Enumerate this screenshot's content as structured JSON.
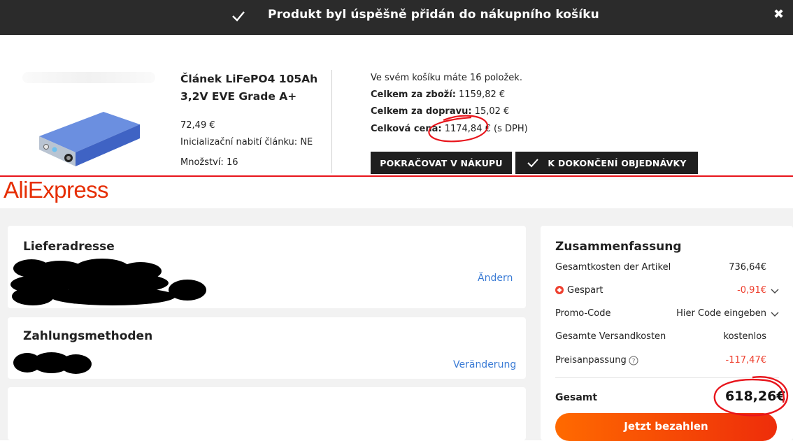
{
  "notification": {
    "message": "Produkt byl úspěšně přidán do nákupního košíku",
    "close_glyph": "✖",
    "icons": {
      "check": "check-icon",
      "close": "close-icon"
    }
  },
  "cart_popup": {
    "product": {
      "name": "Článek LiFePO4 105Ah 3,2V EVE Grade A+",
      "price": "72,49 €",
      "init_label": "Inicializační nabití článku:",
      "init_value": "NE",
      "qty_label": "Množství:",
      "qty_value": "16"
    },
    "summary": {
      "items_text": "Ve svém košíku máte 16 položek.",
      "goods_label": "Celkem za zboží:",
      "goods_value": "1159,82 €",
      "shipping_label": "Celkem za dopravu:",
      "shipping_value": "15,02 €",
      "total_label": "Celková cena:",
      "total_value": "1174,84 € (s DPH)"
    },
    "buttons": {
      "continue": "POKRAČOVAT V NÁKUPU",
      "checkout": "K DOKONČENÍ OBJEDNÁVKY"
    }
  },
  "aliexpress": {
    "logo": "AliExpress",
    "address": {
      "title": "Lieferadresse",
      "change_link": "Ändern"
    },
    "payment": {
      "title": "Zahlungsmethoden",
      "change_link": "Veränderung"
    },
    "summary": {
      "title": "Zusammenfassung",
      "rows": [
        {
          "label": "Gesamtkosten der Artikel",
          "value": "736,64€"
        },
        {
          "label": "Gespart",
          "value": "-0,91€"
        },
        {
          "label": "Promo-Code",
          "value": "Hier Code eingeben"
        },
        {
          "label": "Gesamte Versandkosten",
          "value": "kostenlos"
        },
        {
          "label": "Preisanpassung",
          "value": "-117,47€"
        }
      ],
      "total_label": "Gesamt",
      "total_value": "618,26€",
      "pay_button": "Jetzt bezahlen"
    }
  },
  "colors": {
    "topbar": "#2b2b2b",
    "brand_red": "#e62e04",
    "link_blue": "#3a7bd5",
    "discount_red": "#ee3f2e",
    "annotation_red": "#e8141b"
  }
}
